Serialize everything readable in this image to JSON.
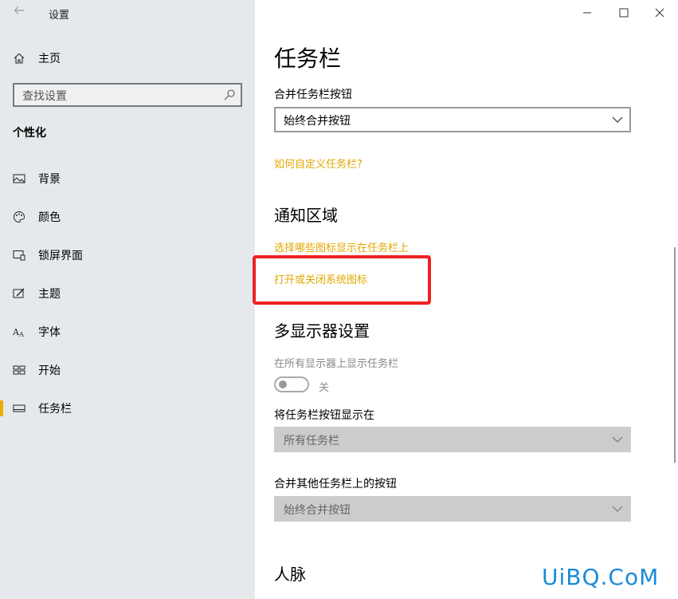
{
  "window": {
    "title": "设置"
  },
  "sidebar": {
    "home_label": "主页",
    "search_placeholder": "查找设置",
    "group_label": "个性化",
    "items": [
      {
        "label": "背景",
        "icon": "picture-icon"
      },
      {
        "label": "颜色",
        "icon": "palette-icon"
      },
      {
        "label": "锁屏界面",
        "icon": "lock-screen-icon"
      },
      {
        "label": "主题",
        "icon": "theme-icon"
      },
      {
        "label": "字体",
        "icon": "font-icon"
      },
      {
        "label": "开始",
        "icon": "start-icon"
      },
      {
        "label": "任务栏",
        "icon": "taskbar-icon",
        "selected": true
      }
    ]
  },
  "main": {
    "title": "任务栏",
    "combine_label": "合并任务栏按钮",
    "combine_value": "始终合并按钮",
    "customize_link": "如何自定义任务栏?",
    "notification_heading": "通知区域",
    "choose_icons_link": "选择哪些图标显示在任务栏上",
    "system_icons_link": "打开或关闭系统图标",
    "multi_display_heading": "多显示器设置",
    "show_all_label": "在所有显示器上显示任务栏",
    "toggle_state": "关",
    "show_buttons_label": "将任务栏按钮显示在",
    "show_buttons_value": "所有任务栏",
    "combine_other_label": "合并其他任务栏上的按钮",
    "combine_other_value": "始终合并按钮",
    "people_heading": "人脉"
  },
  "watermark": "UiBQ.CoM",
  "colors": {
    "accent": "#e8b000",
    "link": "#e0a800",
    "highlight": "#ee2222"
  }
}
